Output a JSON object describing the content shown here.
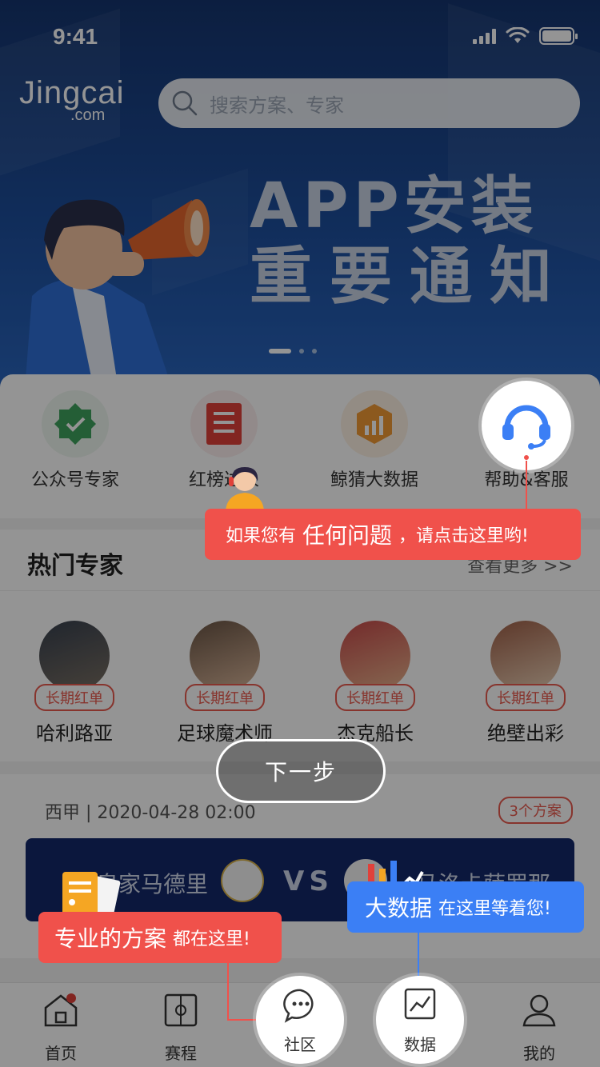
{
  "status_bar": {
    "time": "9:41"
  },
  "logo": {
    "line1": "Jingcai",
    "line2": ".com"
  },
  "search": {
    "placeholder": "搜索方案、专家"
  },
  "banner": {
    "headline_1": "APP安装",
    "headline_2": "重要通知",
    "active_slide": 1,
    "slide_count": 3
  },
  "quick_links": [
    {
      "label": "公众号专家",
      "icon": "shield-check-icon"
    },
    {
      "label": "红榜达人",
      "icon": "document-list-icon"
    },
    {
      "label": "鲸猜大数据",
      "icon": "bar-chart-icon"
    },
    {
      "label": "帮助&客服",
      "icon": "headset-icon"
    }
  ],
  "hot_experts": {
    "title": "热门专家",
    "more": "查看更多 >>",
    "items": [
      {
        "name": "哈利路亚",
        "tag": "长期红单"
      },
      {
        "name": "足球魔术师",
        "tag": "长期红单"
      },
      {
        "name": "杰克船长",
        "tag": "长期红单"
      },
      {
        "name": "绝壁出彩",
        "tag": "长期红单"
      }
    ]
  },
  "match": {
    "league_time": "西甲 | 2020-04-28 02:00",
    "plans": "3个方案",
    "home": "皇家马德里",
    "vs": "VS",
    "away": "马洛卡萨罗那"
  },
  "tabs": [
    {
      "label": "首页",
      "icon": "home-icon"
    },
    {
      "label": "赛程",
      "icon": "schedule-icon"
    },
    {
      "label": "社区",
      "icon": "chat-bubble-icon"
    },
    {
      "label": "数据",
      "icon": "trend-chart-icon"
    },
    {
      "label": "我的",
      "icon": "user-icon"
    }
  ],
  "guide": {
    "next_button": "下一步",
    "tip_help": {
      "pre": "如果您有",
      "big": "任何问题",
      "post": "，请点击这里哟!"
    },
    "tip_data": {
      "big": "大数据",
      "post": "在这里等着您!"
    },
    "tip_plan": {
      "big": "专业的方案",
      "post": "都在这里!"
    }
  },
  "colors": {
    "accent_red": "#f0514b",
    "accent_blue": "#3b7ff5",
    "banner_dark": "#16356f"
  }
}
